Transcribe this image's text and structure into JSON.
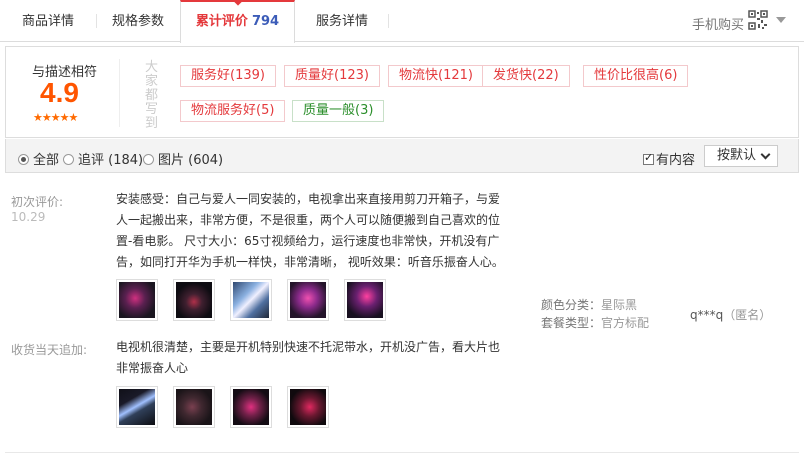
{
  "tabs": [
    {
      "label": "商品详情"
    },
    {
      "label": "规格参数"
    },
    {
      "label": "累计评价",
      "count": "794"
    },
    {
      "label": "服务详情"
    }
  ],
  "mobile_buy": "手机购买",
  "rating": {
    "title": "与描述相符",
    "score": "4.9",
    "stars": "★★★★★"
  },
  "everyone_says": "大家都写到",
  "tags": [
    {
      "label": "服务好(139)",
      "type": "positive"
    },
    {
      "label": "质量好(123)",
      "type": "positive"
    },
    {
      "label": "物流快(121)",
      "type": "positive"
    },
    {
      "label": "发货快(22)",
      "type": "positive"
    },
    {
      "label": "性价比很高(6)",
      "type": "positive"
    },
    {
      "label": "物流服务好(5)",
      "type": "positive"
    },
    {
      "label": "质量一般(3)",
      "type": "negative"
    }
  ],
  "filters": {
    "all": "全部",
    "followup": "追评 (184)",
    "pictures": "图片 (604)",
    "has_content": "有内容",
    "sort": "按默认"
  },
  "review": {
    "initial_label": "初次评价:",
    "initial_date": "10.29",
    "initial_lines": [
      "安装感受：自己与爱人一同安装的，电视拿出来直接用剪刀开箱子，与爱",
      "人一起搬出来，非常方便，不是很重，两个人可以随便搬到自己喜欢的位",
      "置-看电影。 尺寸大小：65寸视频给力，运行速度也非常快，开机没有广",
      "告，如同打开华为手机一样快，非常清晰， 视听效果：听音乐振奋人心。"
    ],
    "color_label": "颜色分类：",
    "color_value": "星际黑",
    "package_label": "套餐类型：",
    "package_value": "官方标配",
    "user": "q***q",
    "anonymous": "（匿名）",
    "followup_label": "收货当天追加:",
    "followup_lines": [
      "电视机很清楚，主要是开机特别快速不托泥带水，开机没广告，看大片也",
      "非常振奋人心"
    ]
  },
  "colors": {
    "accent": "#e4393c",
    "score": "#ff5500",
    "count": "#3c5cb8"
  }
}
